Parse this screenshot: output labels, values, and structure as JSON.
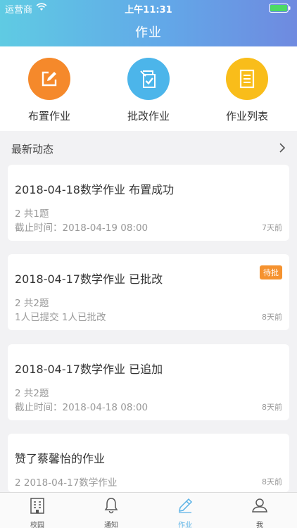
{
  "status_bar": {
    "carrier": "运营商",
    "time": "上午11:31"
  },
  "nav": {
    "title": "作业"
  },
  "quick_actions": [
    {
      "label": "布置作业",
      "icon": "edit-icon",
      "color": "#f5892b"
    },
    {
      "label": "批改作业",
      "icon": "review-check-icon",
      "color": "#4cb5ea"
    },
    {
      "label": "作业列表",
      "icon": "list-document-icon",
      "color": "#f9bd1a"
    }
  ],
  "section": {
    "title": "最新动态"
  },
  "feed": [
    {
      "title": "2018-04-18数学作业 布置成功",
      "line1": "2 共1题",
      "line2": "截止时间：2018-04-19 08:00",
      "age": "7天前",
      "badge": ""
    },
    {
      "title": "2018-04-17数学作业 已批改",
      "line1": "2 共2题",
      "line2": "1人已提交 1人已批改",
      "age": "8天前",
      "badge": "待批"
    },
    {
      "title": "2018-04-17数学作业 已追加",
      "line1": "2 共2题",
      "line2": "截止时间：2018-04-18 08:00",
      "age": "8天前",
      "badge": ""
    },
    {
      "title": "赞了蔡馨怡的作业",
      "line1": "2 2018-04-17数学作业",
      "line2": "",
      "age": "8天前",
      "badge": ""
    }
  ],
  "tabs": [
    {
      "label": "校园",
      "icon": "building-icon",
      "active": false
    },
    {
      "label": "通知",
      "icon": "bell-icon",
      "active": false
    },
    {
      "label": "作业",
      "icon": "pencil-icon",
      "active": true
    },
    {
      "label": "我",
      "icon": "person-icon",
      "active": false
    }
  ],
  "colors": {
    "accent": "#5ab2e6",
    "badge": "#f5922f"
  }
}
